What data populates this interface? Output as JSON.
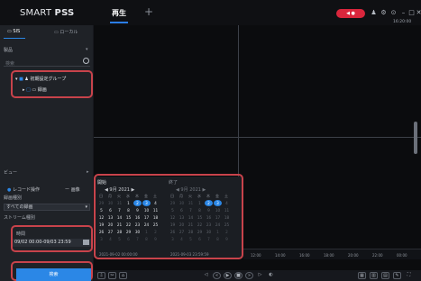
{
  "app": {
    "title_prefix": "SMART",
    "title_bold": "PSS",
    "clock": "16:20:00"
  },
  "tabs": {
    "active": "再生",
    "add": "+"
  },
  "titlebar": {
    "alarm_badge": "◀ ●"
  },
  "sidebar": {
    "tabs": [
      {
        "label": "SIS"
      },
      {
        "label": "ローカル"
      }
    ],
    "section_label": "製品",
    "search_label": "検索",
    "tree": [
      {
        "label": "初期設定グループ"
      },
      {
        "label": "録画"
      }
    ],
    "view_label": "ビュー",
    "options": {
      "record_op": "レコード操作",
      "alarm": "ー 画像"
    },
    "record_type_label": "録画種別",
    "record_type_value": "すべての録画",
    "stream_label": "ストリーム種別",
    "time_label": "時間",
    "time_value": "09/02 00:00-09/03 23:59",
    "search_button": "検索"
  },
  "calendar": {
    "left": {
      "title": "開始",
      "year_month": "9月 2021",
      "from_time": "2021-09-02 00:00:00"
    },
    "right": {
      "title": "終了",
      "year_month": "9月 2021",
      "to_time": "2021-09-03 23:59:59"
    },
    "weekdays": [
      "日",
      "月",
      "火",
      "水",
      "木",
      "金",
      "土"
    ],
    "days": [
      [
        "29",
        "30",
        "31",
        "1",
        "2",
        "3",
        "4"
      ],
      [
        "5",
        "6",
        "7",
        "8",
        "9",
        "10",
        "11"
      ],
      [
        "12",
        "13",
        "14",
        "15",
        "16",
        "17",
        "18"
      ],
      [
        "19",
        "20",
        "21",
        "22",
        "23",
        "24",
        "25"
      ],
      [
        "26",
        "27",
        "28",
        "29",
        "30",
        "1",
        "2"
      ],
      [
        "3",
        "4",
        "5",
        "6",
        "7",
        "8",
        "9"
      ]
    ]
  },
  "timeline": {
    "ticks": [
      "12:00",
      "14:00",
      "16:00",
      "18:00",
      "20:00",
      "22:00",
      "00:00"
    ]
  },
  "colors": {
    "accent": "#2b87e6",
    "highlight": "#c8434b",
    "alarm": "#d9263c"
  }
}
